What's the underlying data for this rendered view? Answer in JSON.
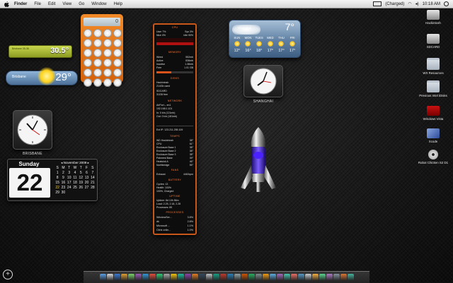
{
  "menubar": {
    "app": "Finder",
    "menus": [
      "File",
      "Edit",
      "View",
      "Go",
      "Window",
      "Help"
    ],
    "battery": "(Charged)",
    "clock": "10:18 AM"
  },
  "temp_bar": {
    "small": "Brisbane 35-36",
    "temp": "30.5°"
  },
  "brisbane_weather": {
    "city": "Brisbane",
    "temp": "29°"
  },
  "calculator": {
    "display": "0"
  },
  "brisbane_clock": {
    "label": "BRISBANE"
  },
  "shanghai_clock": {
    "label": "SHANGHAI"
  },
  "calendar": {
    "day_name": "Sunday",
    "day_number": "22",
    "month": "November 2009",
    "weekdays": [
      "S",
      "M",
      "T",
      "W",
      "T",
      "F",
      "S"
    ],
    "dates": [
      "1",
      "2",
      "3",
      "4",
      "5",
      "6",
      "7",
      "8",
      "9",
      "10",
      "11",
      "12",
      "13",
      "14",
      "15",
      "16",
      "17",
      "18",
      "19",
      "20",
      "21",
      "22",
      "23",
      "24",
      "25",
      "26",
      "27",
      "28",
      "29",
      "30"
    ]
  },
  "istat": {
    "cpu": {
      "title": "CPU",
      "user": "User 7%",
      "sys": "Sys 3%",
      "nice": "Nice 0%",
      "idle": "Idle 90%"
    },
    "memory": {
      "title": "MEMORY",
      "wired": [
        "Wired",
        "552mb"
      ],
      "active": [
        "Active",
        "836mb"
      ],
      "inactive": [
        "Inactive",
        "1.38mb"
      ],
      "free": [
        "Free",
        "1.01 GB"
      ]
    },
    "disks": {
      "title": "DISKS",
      "d1": "Hackintosh",
      "d1_info": "214Gb used",
      "d2": "SDCARD",
      "d2_info": "31GB free"
    },
    "network": {
      "title": "NETWORK",
      "iface": "AirPort – en1",
      "ip": "192.168.1.101",
      "in": "In: 0 b/s (121mb)",
      "out": "Out: 0 b/s (181mb)",
      "ext_ip": "Ext IP: 123.211.255.109"
    },
    "temps": {
      "title": "TEMPS",
      "rows": [
        [
          "WD Hackintosh",
          "38°"
        ],
        [
          "CPU",
          "61°"
        ],
        [
          "Enclosure Base 1",
          "38°"
        ],
        [
          "Enclosure Base 2",
          "38°"
        ],
        [
          "Enclosure Base 3",
          "38°"
        ],
        [
          "Palmrest Base",
          "39°"
        ],
        [
          "Heatsink A",
          "46°"
        ],
        [
          "Northbridge",
          "55°"
        ]
      ]
    },
    "fans": {
      "title": "FANS",
      "row": [
        "Exhaust",
        "4463rpm"
      ]
    },
    "battery": {
      "title": "BATTERY",
      "cycles": "Cycles: 13",
      "health": "Health: 100%",
      "status": "100%, Charged"
    },
    "uptime": {
      "title": "UPTIME",
      "line1": "Uptime: 8d 10h 56m",
      "line2": "Load: 2.25, 2.18, 2.28",
      "line3": "Processes: 85"
    },
    "processes": {
      "title": "PROCESSES",
      "rows": [
        [
          "WindowSer...",
          "3.8%"
        ],
        [
          "dk",
          "2.8%"
        ],
        [
          "Microsoft ...",
          "1.1%"
        ],
        [
          "Citrix onlin...",
          "1.0%"
        ]
      ]
    }
  },
  "shanghai_weather": {
    "city": "Shanghai",
    "temp": "7°",
    "days": [
      "SUN",
      "MON",
      "TUES",
      "WED",
      "THU",
      "FRI"
    ],
    "highs": [
      "12°",
      "16°",
      "18°",
      "17°",
      "17°",
      "17°"
    ]
  },
  "desktop_icons": [
    {
      "name": "Hackintosh",
      "type": "drive"
    },
    {
      "name": "SDCARD",
      "type": "drive"
    },
    {
      "name": "WX Resources",
      "type": "folder"
    },
    {
      "name": "Previous Intel iDisks",
      "type": "folder"
    },
    {
      "name": "Windows Vista",
      "type": "app"
    },
    {
      "name": "Xcode",
      "type": "app"
    },
    {
      "name": "Robot Chicken S2 D1",
      "type": "disc"
    }
  ],
  "add_widget": "+",
  "accent": "#c8581a"
}
